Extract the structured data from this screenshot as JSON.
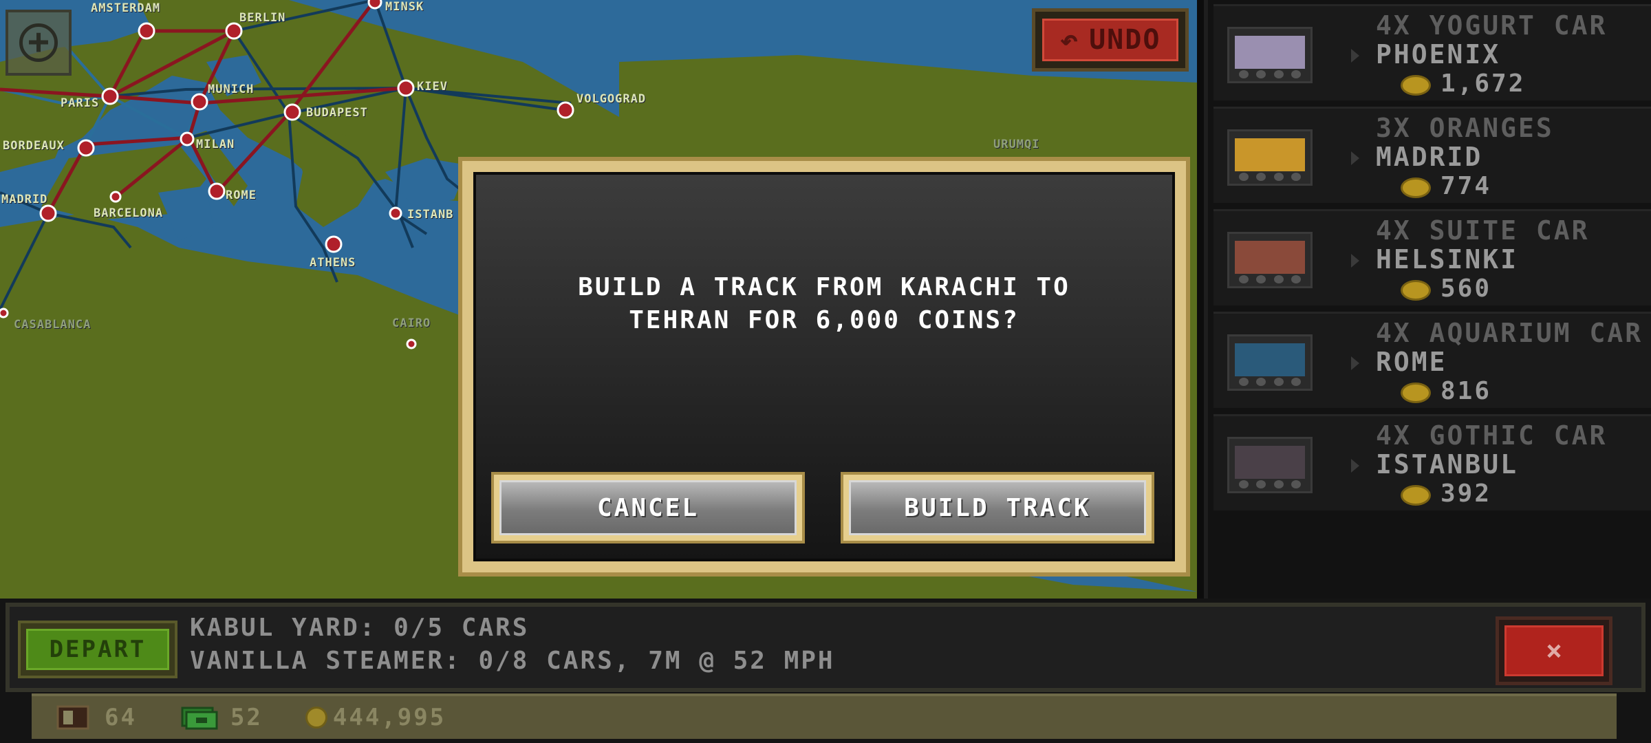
{
  "map": {
    "cities": [
      {
        "id": "amsterdam",
        "label": "AMSTERDAM"
      },
      {
        "id": "berlin",
        "label": "BERLIN"
      },
      {
        "id": "minsk",
        "label": "MINSK"
      },
      {
        "id": "paris",
        "label": "PARIS"
      },
      {
        "id": "munich",
        "label": "MUNICH"
      },
      {
        "id": "kiev",
        "label": "KIEV"
      },
      {
        "id": "budapest",
        "label": "BUDAPEST"
      },
      {
        "id": "volgograd",
        "label": "VOLGOGRAD"
      },
      {
        "id": "bordeaux",
        "label": "BORDEAUX"
      },
      {
        "id": "milan",
        "label": "MILAN"
      },
      {
        "id": "rome",
        "label": "ROME"
      },
      {
        "id": "madrid",
        "label": "MADRID"
      },
      {
        "id": "barcelona",
        "label": "BARCELONA"
      },
      {
        "id": "istanbul",
        "label": "ISTANB"
      },
      {
        "id": "athens",
        "label": "ATHENS"
      },
      {
        "id": "casablanca",
        "label": "CASABLANCA"
      },
      {
        "id": "cairo",
        "label": "CAIRO"
      },
      {
        "id": "urumqi",
        "label": "URUMQI"
      }
    ],
    "zoom_icon": "zoom-in-icon",
    "undo_label": "UNDO",
    "undo_icon": "undo-arrow-icon"
  },
  "orders": [
    {
      "qty": "4X YOGURT CAR",
      "dest": "PHOENIX",
      "pay": "1,672",
      "car_color": "#9a8fb0"
    },
    {
      "qty": "3X ORANGES",
      "dest": "MADRID",
      "pay": "774",
      "car_color": "#c9962a"
    },
    {
      "qty": "4X SUITE CAR",
      "dest": "HELSINKI",
      "pay": "560",
      "car_color": "#8a4a3a"
    },
    {
      "qty": "4X AQUARIUM CAR",
      "dest": "ROME",
      "pay": "816",
      "car_color": "#2a5a7a"
    },
    {
      "qty": "4X GOTHIC CAR",
      "dest": "ISTANBUL",
      "pay": "392",
      "car_color": "#4a4048"
    }
  ],
  "modal": {
    "line1": "BUILD A TRACK FROM KARACHI TO",
    "line2": "TEHRAN FOR 6,000 COINS?",
    "cancel_label": "CANCEL",
    "build_label": "BUILD TRACK"
  },
  "train": {
    "depart_label": "DEPART",
    "yard_line": "KABUL YARD: 0/5 CARS",
    "engine_line": "VANILLA STEAMER: 0/8 CARS, 7M @ 52 MPH",
    "close_icon": "close-icon",
    "close_label": "×"
  },
  "stats": {
    "cars": "64",
    "cash": "52",
    "coins": "444,995"
  },
  "colors": {
    "accent_gold": "#dcc485",
    "depart_green": "#4e8a18",
    "close_red": "#b0231d",
    "undo_red": "#a82a22"
  }
}
